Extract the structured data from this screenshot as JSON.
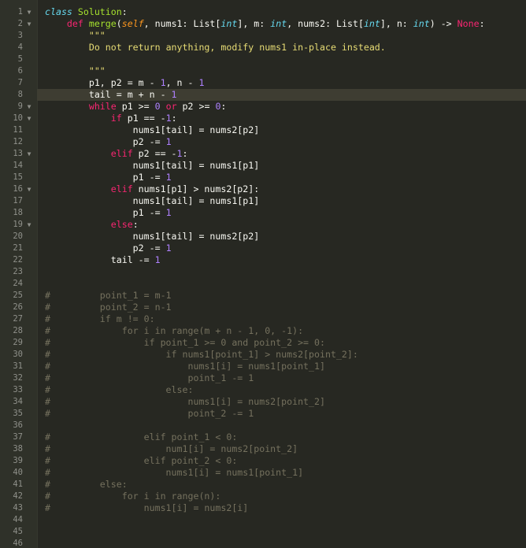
{
  "editor": {
    "theme_colors": {
      "background": "#272822",
      "gutter": "#2f3129",
      "active_line": "#3e3d32",
      "keyword": "#f92672",
      "function_name": "#a6e22e",
      "number": "#ae81ff",
      "string": "#e6db74",
      "comment": "#75715e",
      "type": "#66d9ef"
    },
    "fold_icon": "triangle-down-icon",
    "active_line_number": 8,
    "lines": [
      {
        "num": "1",
        "fold": true,
        "tokens": [
          [
            "c",
            "class"
          ],
          [
            "",
            " "
          ],
          [
            "n",
            "Solution"
          ],
          [
            "",
            ":"
          ]
        ]
      },
      {
        "num": "2",
        "fold": true,
        "tokens": [
          [
            "",
            "    "
          ],
          [
            "k",
            "def"
          ],
          [
            "",
            " "
          ],
          [
            "n",
            "merge"
          ],
          [
            "",
            "("
          ],
          [
            "p",
            "self"
          ],
          [
            "",
            ", nums1: List["
          ],
          [
            "t",
            "int"
          ],
          [
            "",
            "], m: "
          ],
          [
            "t",
            "int"
          ],
          [
            "",
            ", nums2: List["
          ],
          [
            "t",
            "int"
          ],
          [
            "",
            "], n: "
          ],
          [
            "t",
            "int"
          ],
          [
            "",
            ") -> "
          ],
          [
            "k",
            "None"
          ],
          [
            "",
            ":"
          ]
        ]
      },
      {
        "num": "3",
        "fold": false,
        "tokens": [
          [
            "",
            "        "
          ],
          [
            "s",
            "\"\"\""
          ]
        ]
      },
      {
        "num": "4",
        "fold": false,
        "tokens": [
          [
            "",
            "        "
          ],
          [
            "s",
            "Do not return anything, modify nums1 in-place instead."
          ]
        ]
      },
      {
        "num": "5",
        "fold": false,
        "tokens": []
      },
      {
        "num": "6",
        "fold": false,
        "tokens": [
          [
            "",
            "        "
          ],
          [
            "s",
            "\"\"\""
          ]
        ]
      },
      {
        "num": "7",
        "fold": false,
        "tokens": [
          [
            "",
            "        p1, p2 = m - "
          ],
          [
            "m",
            "1"
          ],
          [
            "",
            ", n - "
          ],
          [
            "m",
            "1"
          ]
        ]
      },
      {
        "num": "8",
        "fold": false,
        "tokens": [
          [
            "",
            "        tail = m + n - "
          ],
          [
            "m",
            "1"
          ]
        ]
      },
      {
        "num": "9",
        "fold": true,
        "tokens": [
          [
            "",
            "        "
          ],
          [
            "k",
            "while"
          ],
          [
            "",
            " p1 >= "
          ],
          [
            "m",
            "0"
          ],
          [
            "",
            " "
          ],
          [
            "k",
            "or"
          ],
          [
            "",
            " p2 >= "
          ],
          [
            "m",
            "0"
          ],
          [
            "",
            ":"
          ]
        ]
      },
      {
        "num": "10",
        "fold": true,
        "tokens": [
          [
            "",
            "            "
          ],
          [
            "k",
            "if"
          ],
          [
            "",
            " p1 == -"
          ],
          [
            "m",
            "1"
          ],
          [
            "",
            ":"
          ]
        ]
      },
      {
        "num": "11",
        "fold": false,
        "tokens": [
          [
            "",
            "                nums1[tail] = nums2[p2]"
          ]
        ]
      },
      {
        "num": "12",
        "fold": false,
        "tokens": [
          [
            "",
            "                p2 -= "
          ],
          [
            "m",
            "1"
          ]
        ]
      },
      {
        "num": "13",
        "fold": true,
        "tokens": [
          [
            "",
            "            "
          ],
          [
            "k",
            "elif"
          ],
          [
            "",
            " p2 == -"
          ],
          [
            "m",
            "1"
          ],
          [
            "",
            ":"
          ]
        ]
      },
      {
        "num": "14",
        "fold": false,
        "tokens": [
          [
            "",
            "                nums1[tail] = nums1[p1]"
          ]
        ]
      },
      {
        "num": "15",
        "fold": false,
        "tokens": [
          [
            "",
            "                p1 -= "
          ],
          [
            "m",
            "1"
          ]
        ]
      },
      {
        "num": "16",
        "fold": true,
        "tokens": [
          [
            "",
            "            "
          ],
          [
            "k",
            "elif"
          ],
          [
            "",
            " nums1[p1] > nums2[p2]:"
          ]
        ]
      },
      {
        "num": "17",
        "fold": false,
        "tokens": [
          [
            "",
            "                nums1[tail] = nums1[p1]"
          ]
        ]
      },
      {
        "num": "18",
        "fold": false,
        "tokens": [
          [
            "",
            "                p1 -= "
          ],
          [
            "m",
            "1"
          ]
        ]
      },
      {
        "num": "19",
        "fold": true,
        "tokens": [
          [
            "",
            "            "
          ],
          [
            "k",
            "else"
          ],
          [
            "",
            ":"
          ]
        ]
      },
      {
        "num": "20",
        "fold": false,
        "tokens": [
          [
            "",
            "                nums1[tail] = nums2[p2]"
          ]
        ]
      },
      {
        "num": "21",
        "fold": false,
        "tokens": [
          [
            "",
            "                p2 -= "
          ],
          [
            "m",
            "1"
          ]
        ]
      },
      {
        "num": "22",
        "fold": false,
        "tokens": [
          [
            "",
            "            tail -= "
          ],
          [
            "m",
            "1"
          ]
        ]
      },
      {
        "num": "23",
        "fold": false,
        "tokens": []
      },
      {
        "num": "24",
        "fold": false,
        "tokens": []
      },
      {
        "num": "25",
        "fold": false,
        "tokens": [
          [
            "cm",
            "#         point_1 = m-1"
          ]
        ]
      },
      {
        "num": "26",
        "fold": false,
        "tokens": [
          [
            "cm",
            "#         point_2 = n-1"
          ]
        ]
      },
      {
        "num": "27",
        "fold": false,
        "tokens": [
          [
            "cm",
            "#         if m != 0:"
          ]
        ]
      },
      {
        "num": "28",
        "fold": false,
        "tokens": [
          [
            "cm",
            "#             for i in range(m + n - 1, 0, -1):"
          ]
        ]
      },
      {
        "num": "29",
        "fold": false,
        "tokens": [
          [
            "cm",
            "#                 if point_1 >= 0 and point_2 >= 0:"
          ]
        ]
      },
      {
        "num": "30",
        "fold": false,
        "tokens": [
          [
            "cm",
            "#                     if nums1[point_1] > nums2[point_2]:"
          ]
        ]
      },
      {
        "num": "31",
        "fold": false,
        "tokens": [
          [
            "cm",
            "#                         nums1[i] = nums1[point_1]"
          ]
        ]
      },
      {
        "num": "32",
        "fold": false,
        "tokens": [
          [
            "cm",
            "#                         point_1 -= 1"
          ]
        ]
      },
      {
        "num": "33",
        "fold": false,
        "tokens": [
          [
            "cm",
            "#                     else:"
          ]
        ]
      },
      {
        "num": "34",
        "fold": false,
        "tokens": [
          [
            "cm",
            "#                         nums1[i] = nums2[point_2]"
          ]
        ]
      },
      {
        "num": "35",
        "fold": false,
        "tokens": [
          [
            "cm",
            "#                         point_2 -= 1"
          ]
        ]
      },
      {
        "num": "36",
        "fold": false,
        "tokens": []
      },
      {
        "num": "37",
        "fold": false,
        "tokens": [
          [
            "cm",
            "#                 elif point_1 < 0:"
          ]
        ]
      },
      {
        "num": "38",
        "fold": false,
        "tokens": [
          [
            "cm",
            "#                     num1[i] = nums2[point_2]"
          ]
        ]
      },
      {
        "num": "39",
        "fold": false,
        "tokens": [
          [
            "cm",
            "#                 elif point_2 < 0:"
          ]
        ]
      },
      {
        "num": "40",
        "fold": false,
        "tokens": [
          [
            "cm",
            "#                     nums1[i] = nums1[point_1]"
          ]
        ]
      },
      {
        "num": "41",
        "fold": false,
        "tokens": [
          [
            "cm",
            "#         else:"
          ]
        ]
      },
      {
        "num": "42",
        "fold": false,
        "tokens": [
          [
            "cm",
            "#             for i in range(n):"
          ]
        ]
      },
      {
        "num": "43",
        "fold": false,
        "tokens": [
          [
            "cm",
            "#                 nums1[i] = nums2[i]"
          ]
        ]
      },
      {
        "num": "44",
        "fold": false,
        "tokens": []
      },
      {
        "num": "45",
        "fold": false,
        "tokens": []
      },
      {
        "num": "46",
        "fold": false,
        "tokens": []
      }
    ]
  }
}
